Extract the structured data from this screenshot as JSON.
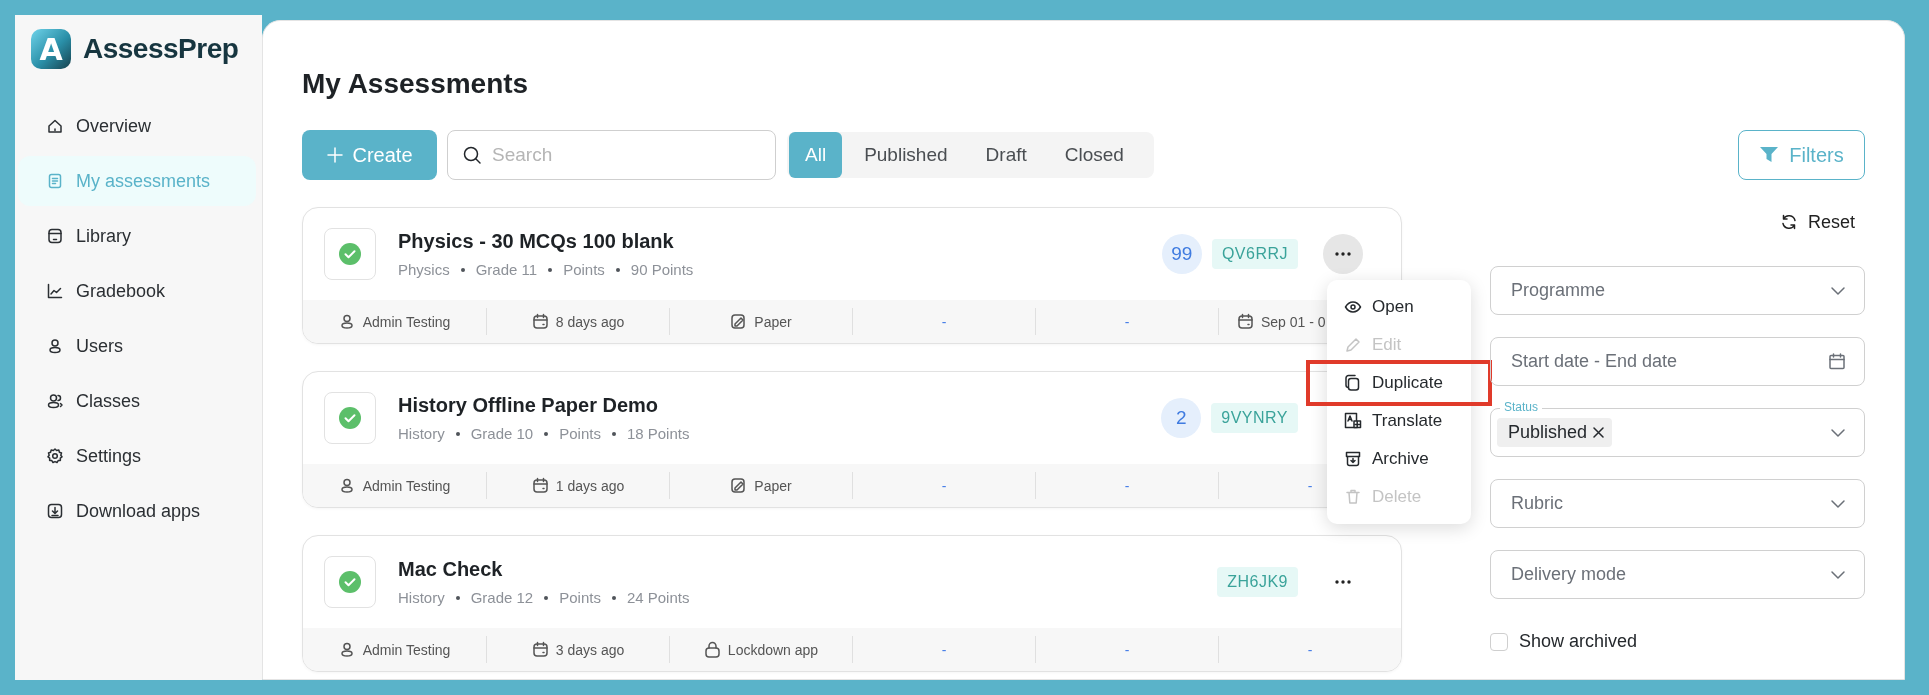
{
  "sidebar": {
    "logo_letter": "A",
    "brand": "AssessPrep",
    "items": [
      {
        "label": "Overview",
        "selected": false
      },
      {
        "label": "My assessments",
        "selected": true
      },
      {
        "label": "Library",
        "selected": false
      },
      {
        "label": "Gradebook",
        "selected": false
      },
      {
        "label": "Users",
        "selected": false
      },
      {
        "label": "Classes",
        "selected": false
      },
      {
        "label": "Settings",
        "selected": false
      },
      {
        "label": "Download apps",
        "selected": false
      }
    ]
  },
  "page": {
    "title": "My Assessments"
  },
  "toolbar": {
    "create": "Create",
    "search": {
      "placeholder": "Search"
    },
    "tabs": [
      {
        "label": "All",
        "selected": true
      },
      {
        "label": "Published",
        "selected": false
      },
      {
        "label": "Draft",
        "selected": false
      },
      {
        "label": "Closed",
        "selected": false
      }
    ],
    "filters_button": "Filters"
  },
  "cards": [
    {
      "title": "Physics - 30 MCQs 100 blank",
      "meta": [
        "Physics",
        "Grade 11",
        "Points",
        "90 Points"
      ],
      "count": "99",
      "code": "QV6RRJ",
      "more_pressed": true,
      "footer": [
        {
          "kind": "person",
          "text": "Admin Testing"
        },
        {
          "kind": "date",
          "text": "8 days ago"
        },
        {
          "kind": "paper",
          "text": "Paper"
        },
        {
          "kind": "dash",
          "text": "-"
        },
        {
          "kind": "dash",
          "text": "-"
        },
        {
          "kind": "schedule",
          "text": "Sep 01 - 0"
        }
      ]
    },
    {
      "title": "History Offline Paper Demo",
      "meta": [
        "History",
        "Grade 10",
        "Points",
        "18 Points"
      ],
      "count": "2",
      "code": "9VYNRY",
      "footer": [
        {
          "kind": "person",
          "text": "Admin Testing"
        },
        {
          "kind": "date",
          "text": "1 days ago"
        },
        {
          "kind": "paper",
          "text": "Paper"
        },
        {
          "kind": "dash",
          "text": "-"
        },
        {
          "kind": "dash",
          "text": "-"
        },
        {
          "kind": "dash",
          "text": "-"
        }
      ]
    },
    {
      "title": "Mac Check",
      "meta": [
        "History",
        "Grade 12",
        "Points",
        "24 Points"
      ],
      "code": "ZH6JK9",
      "more_pressed": false,
      "footer": [
        {
          "kind": "person",
          "text": "Admin Testing"
        },
        {
          "kind": "date",
          "text": "3 days ago"
        },
        {
          "kind": "lock",
          "text": "Lockdown app"
        },
        {
          "kind": "dash",
          "text": "-"
        },
        {
          "kind": "dash",
          "text": "-"
        },
        {
          "kind": "dash",
          "text": "-"
        }
      ]
    }
  ],
  "menu": {
    "items": [
      {
        "label": "Open",
        "disabled": false,
        "highlighted": false
      },
      {
        "label": "Edit",
        "disabled": true,
        "highlighted": false
      },
      {
        "label": "Duplicate",
        "disabled": false,
        "highlighted": true
      },
      {
        "label": "Translate",
        "disabled": false,
        "highlighted": false
      },
      {
        "label": "Archive",
        "disabled": false,
        "highlighted": false
      },
      {
        "label": "Delete",
        "disabled": true,
        "highlighted": false
      }
    ]
  },
  "filters": {
    "reset": "Reset",
    "fields": [
      {
        "kind": "select",
        "placeholder": "Programme"
      },
      {
        "kind": "date",
        "placeholder": "Start date - End date"
      },
      {
        "kind": "select",
        "label": "Status",
        "chips": [
          "Published"
        ]
      },
      {
        "kind": "select",
        "placeholder": "Rubric"
      },
      {
        "kind": "select",
        "placeholder": "Delivery mode"
      }
    ],
    "show_archived": {
      "label": "Show archived",
      "checked": false
    }
  }
}
